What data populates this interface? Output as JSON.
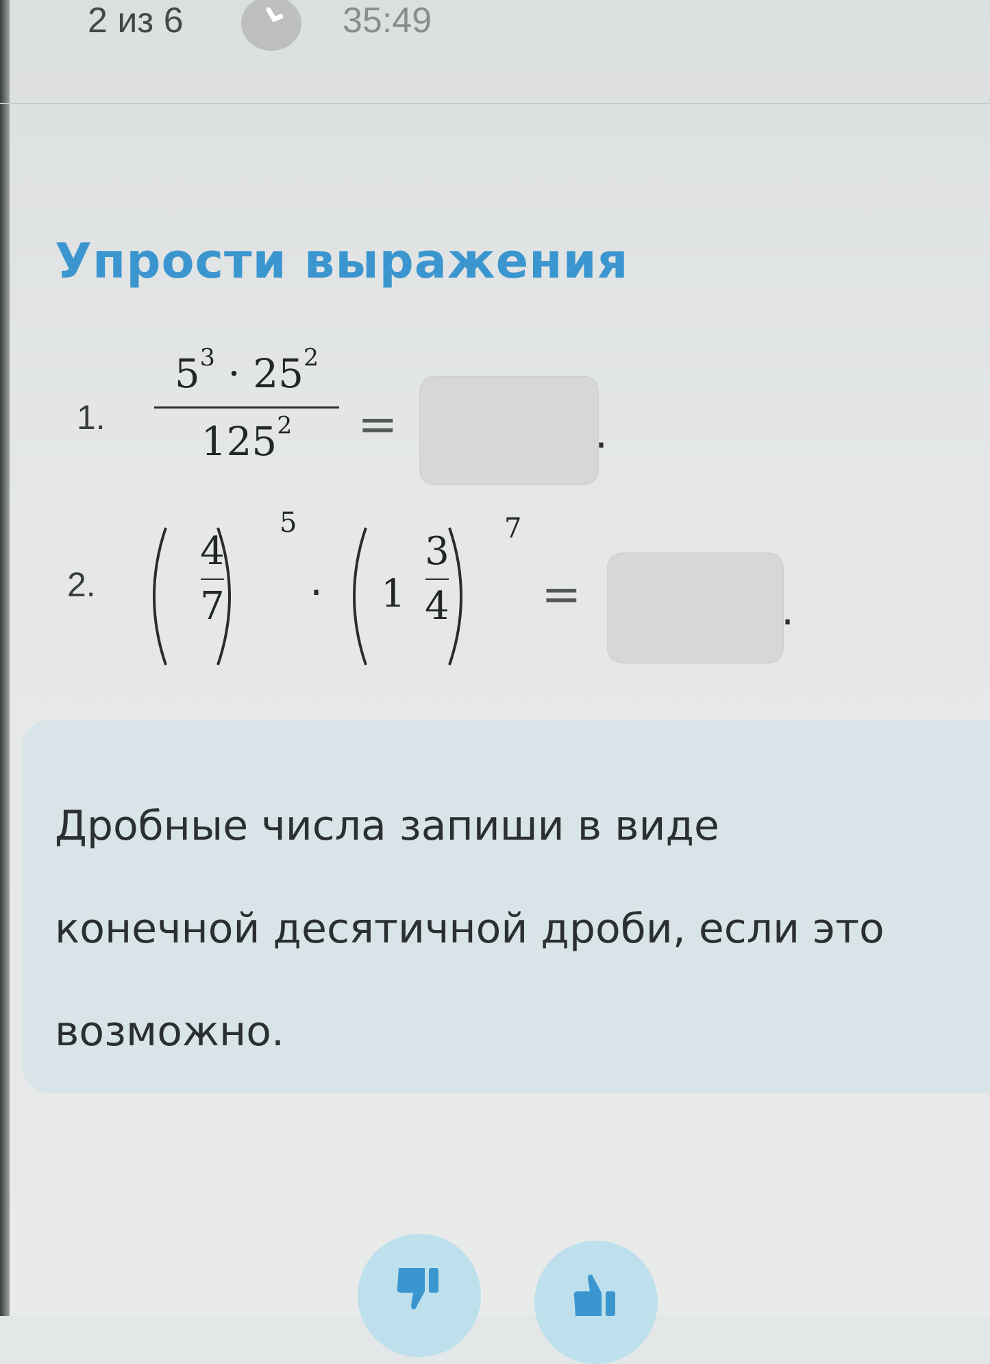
{
  "header": {
    "counter": "2 из 6",
    "timer": "35:49"
  },
  "task": {
    "title": "Упрости выражения",
    "problem1": {
      "number": "1.",
      "numerator_base_a": "5",
      "numerator_exp_a": "3",
      "numerator_op": "·",
      "numerator_base_b": "25",
      "numerator_exp_b": "2",
      "denominator_base": "125",
      "denominator_exp": "2",
      "equals": "=",
      "answer_value": "",
      "end_punct": "."
    },
    "problem2": {
      "number": "2.",
      "frac1_top": "4",
      "frac1_bottom": "7",
      "exp1": "5",
      "op": "·",
      "whole2": "1",
      "frac2_top": "3",
      "frac2_bottom": "4",
      "exp2": "7",
      "equals": "=",
      "answer_value": "",
      "end_punct": "."
    }
  },
  "hint": {
    "text": "Дробные числа запиши в виде конечной десятичной дроби, если это возможно."
  },
  "feedback": {
    "dislike_icon": "thumbs-down-icon",
    "like_icon": "thumbs-up-icon",
    "accent_color": "#3b96cf"
  }
}
